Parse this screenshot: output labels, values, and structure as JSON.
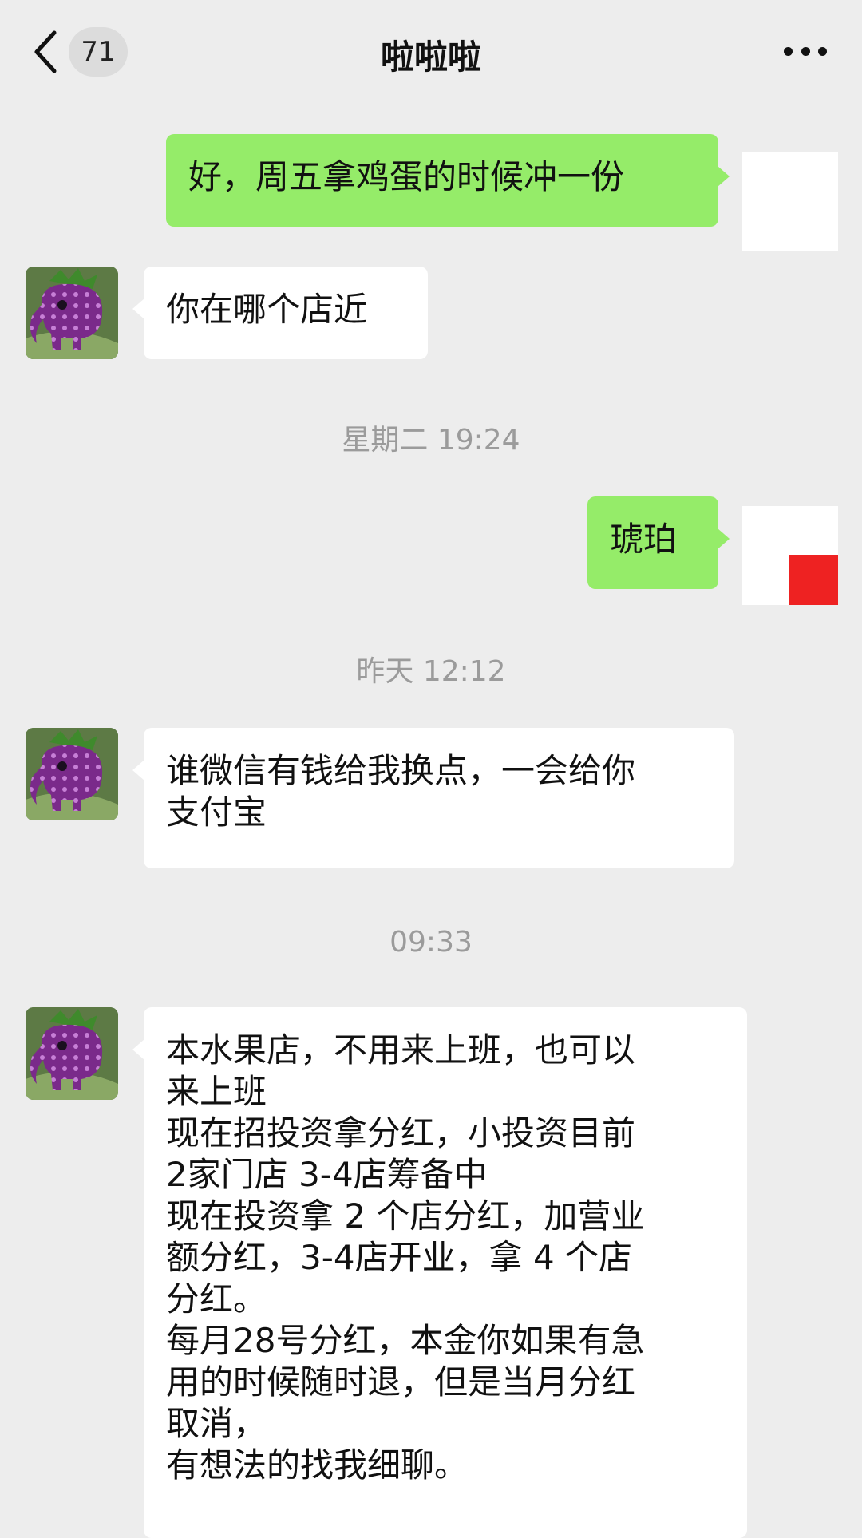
{
  "header": {
    "unread_count": "71",
    "title": "啦啦啦"
  },
  "messages": [
    {
      "text": "好，周五拿鸡蛋的时候冲一份"
    },
    {
      "text": "你在哪个店近"
    },
    {
      "text": "琥珀"
    },
    {
      "text": "谁微信有钱给我换点，一会给你\n支付宝"
    },
    {
      "text": "本水果店，不用来上班，也可以\n来上班\n现在招投资拿分红，小投资目前\n2家门店 3-4店筹备中\n现在投资拿 2 个店分红，加营业\n额分红，3-4店开业，拿 4 个店\n分红。\n每月28号分红，本金你如果有急\n用的时候随时退，但是当月分红\n取消，\n有想法的找我细聊。"
    }
  ],
  "timestamps": [
    "星期二 19:24",
    "昨天 12:12",
    "09:33"
  ],
  "colors": {
    "background": "#ededed",
    "outgoing_bubble": "#95ec69",
    "incoming_bubble": "#ffffff",
    "timestamp_text": "#9b9b9b"
  },
  "icons": [
    "chevron-left-icon",
    "more-dots-icon",
    "strawberry-elephant-avatar"
  ]
}
